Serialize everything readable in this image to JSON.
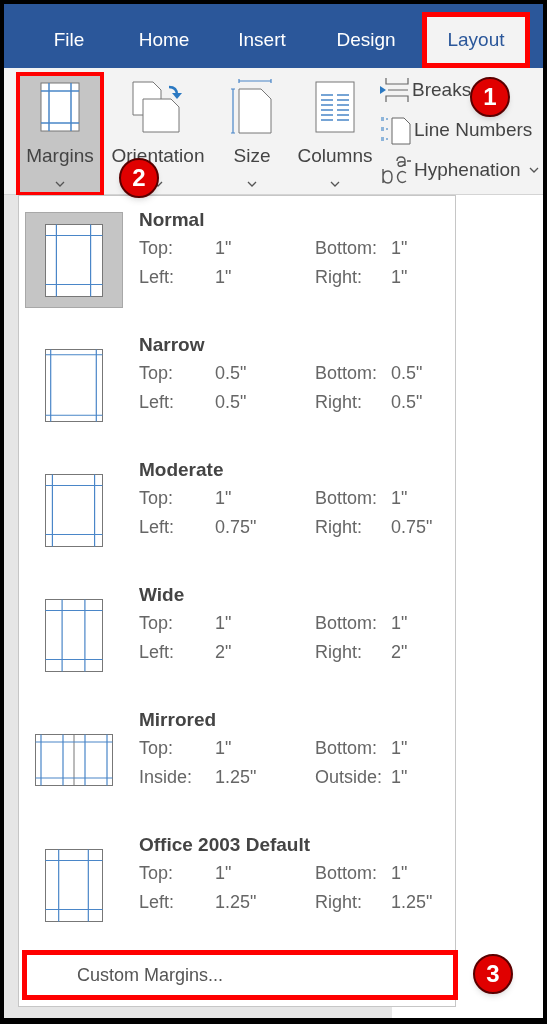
{
  "tabs": [
    {
      "label": "File",
      "selected": false,
      "highlighted": false
    },
    {
      "label": "Home",
      "selected": false,
      "highlighted": false
    },
    {
      "label": "Insert",
      "selected": false,
      "highlighted": false
    },
    {
      "label": "Design",
      "selected": false,
      "highlighted": false
    },
    {
      "label": "Layout",
      "selected": true,
      "highlighted": true,
      "badge": "1"
    }
  ],
  "ribbon": {
    "large_buttons": [
      {
        "label": "Margins",
        "kind": "margins",
        "selected": true,
        "highlighted": true,
        "badge": "2"
      },
      {
        "label": "Orientation",
        "kind": "orientation",
        "selected": false,
        "highlighted": false
      },
      {
        "label": "Size",
        "kind": "size",
        "selected": false,
        "highlighted": false
      },
      {
        "label": "Columns",
        "kind": "columns",
        "selected": false,
        "highlighted": false
      }
    ],
    "small_buttons": [
      {
        "label": "Breaks",
        "kind": "breaks"
      },
      {
        "label": "Line Numbers",
        "kind": "line-numbers"
      },
      {
        "label": "Hyphenation",
        "kind": "hyphenation"
      }
    ]
  },
  "margins_menu": {
    "presets": [
      {
        "name": "Normal",
        "kind": "normal",
        "selected": true,
        "rows": [
          [
            "Top:",
            "1\"",
            "Bottom:",
            "1\""
          ],
          [
            "Left:",
            "1\"",
            "Right:",
            "1\""
          ]
        ]
      },
      {
        "name": "Narrow",
        "kind": "narrow",
        "selected": false,
        "rows": [
          [
            "Top:",
            "0.5\"",
            "Bottom:",
            "0.5\""
          ],
          [
            "Left:",
            "0.5\"",
            "Right:",
            "0.5\""
          ]
        ]
      },
      {
        "name": "Moderate",
        "kind": "moderate",
        "selected": false,
        "rows": [
          [
            "Top:",
            "1\"",
            "Bottom:",
            "1\""
          ],
          [
            "Left:",
            "0.75\"",
            "Right:",
            "0.75\""
          ]
        ]
      },
      {
        "name": "Wide",
        "kind": "wide",
        "selected": false,
        "rows": [
          [
            "Top:",
            "1\"",
            "Bottom:",
            "1\""
          ],
          [
            "Left:",
            "2\"",
            "Right:",
            "2\""
          ]
        ]
      },
      {
        "name": "Mirrored",
        "kind": "mirrored",
        "selected": false,
        "rows": [
          [
            "Top:",
            "1\"",
            "Bottom:",
            "1\""
          ],
          [
            "Inside:",
            "1.25\"",
            "Outside:",
            "1\""
          ]
        ]
      },
      {
        "name": "Office 2003 Default",
        "kind": "office2003",
        "selected": false,
        "rows": [
          [
            "Top:",
            "1\"",
            "Bottom:",
            "1\""
          ],
          [
            "Left:",
            "1.25\"",
            "Right:",
            "1.25\""
          ]
        ]
      }
    ],
    "custom": {
      "label": "Custom Margins...",
      "highlighted": true,
      "badge": "3"
    }
  }
}
